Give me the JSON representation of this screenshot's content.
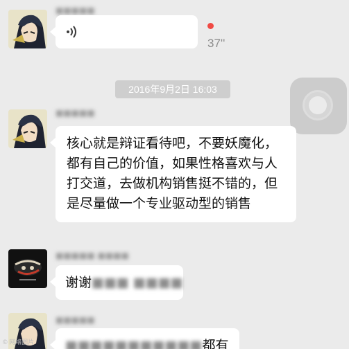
{
  "messages": [
    {
      "sender_name": "■■■■■",
      "type": "voice",
      "duration": "37''",
      "unread": true
    },
    {
      "timestamp": "2016年9月2日 16:03"
    },
    {
      "sender_name": "■■■■■",
      "type": "text",
      "text": "核心就是辩证看待吧，不要妖魔化，都有自己的价值，如果性格喜欢与人打交道，去做机构销售挺不错的，但是尽量做一个专业驱动型的销售"
    },
    {
      "sender_name": "■■■■■ ■■■■",
      "type": "text",
      "text_visible": "谢谢",
      "text_redacted": "■■■ ■■■■"
    },
    {
      "sender_name": "■■■■■",
      "type": "text",
      "text_redacted": "■■■■■■■■■■■",
      "text_visible": "都有"
    }
  ],
  "watermark": "© 网络图片",
  "colors": {
    "background": "#ebebeb",
    "bubble": "#ffffff",
    "unread_dot": "#f04a44",
    "timestamp_bg": "#cecece"
  },
  "icons": {
    "voice": "sound-wave-icon",
    "floating": "assistive-touch-icon"
  }
}
